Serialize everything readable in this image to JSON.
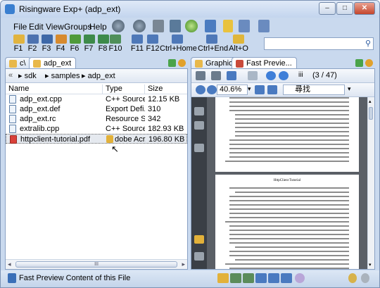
{
  "window": {
    "title": "Risingware Exp+ (adp_ext)",
    "minimize": "–",
    "maximize": "□",
    "close": "✕"
  },
  "menu": [
    "File",
    "Edit",
    "View",
    "Groups",
    "Help"
  ],
  "fkeys": [
    "F1",
    "F2",
    "F3",
    "F4",
    "F6",
    "F7",
    "F8",
    "F10",
    "F11",
    "F12",
    "Ctrl+Home",
    "Ctrl+End",
    "Alt+O"
  ],
  "left_tabs": {
    "t1": "c\\",
    "t2": "adp_ext"
  },
  "breadcrumb": [
    "sdk",
    "samples",
    "adp_ext"
  ],
  "file_table": {
    "columns": [
      "Name",
      "Type",
      "Size"
    ],
    "rows": [
      {
        "name": "adp_ext.cpp",
        "type": "C++ Source",
        "size": "12.15 KB"
      },
      {
        "name": "adp_ext.def",
        "type": "Export Defi...",
        "size": "310"
      },
      {
        "name": "adp_ext.rc",
        "type": "Resource S...",
        "size": "342"
      },
      {
        "name": "extralib.cpp",
        "type": "C++ Source",
        "size": "182.93 KB"
      },
      {
        "name": "httpclient-tutorial.pdf",
        "type": "dobe Acr...",
        "size": "196.80 KB"
      }
    ]
  },
  "hscroll_label": "III",
  "right_tabs": {
    "t1": "Graphics",
    "t2": "Fast Previe..."
  },
  "pdf": {
    "page_counter": "(3 / 47)",
    "zoom": "40.6%",
    "find": "尋找",
    "page_title": "HttpClient Tutorial"
  },
  "status": {
    "text": "Fast Preview Content of this File"
  }
}
